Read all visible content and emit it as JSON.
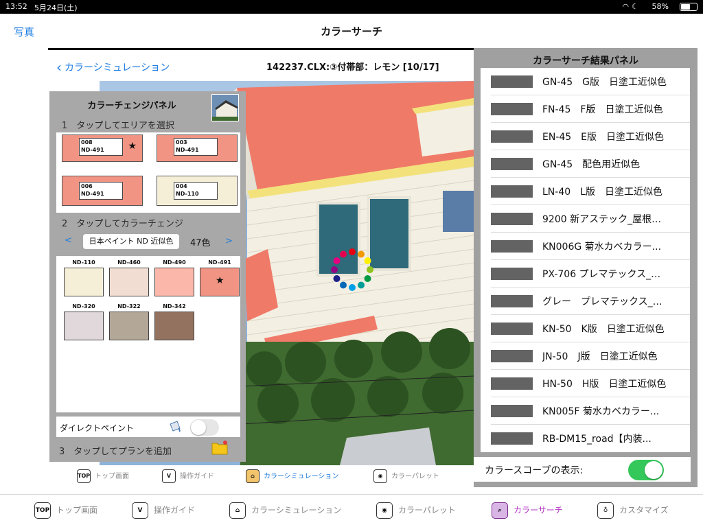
{
  "status_bar": {
    "time": "13:52",
    "date": "5月24日(土)",
    "battery": "58%",
    "battery_level": 0.58
  },
  "nav": {
    "back_label": "写真",
    "title": "カラーサーチ"
  },
  "sim": {
    "back_label": "カラーシミュレーション",
    "file_title": "142237.CLX:③付帯部：レモン [10/17]"
  },
  "change_panel": {
    "title": "カラーチェンジパネル",
    "step1": "1　タップしてエリアを選択",
    "areas": [
      {
        "code": "008",
        "name": "ND-491",
        "color": "#f19484",
        "starred": true
      },
      {
        "code": "003",
        "name": "ND-491",
        "color": "#f19484",
        "starred": false
      },
      {
        "code": "006",
        "name": "ND-491",
        "color": "#f19484",
        "starred": false
      },
      {
        "code": "004",
        "name": "ND-110",
        "color": "#f6efd8",
        "starred": false
      }
    ],
    "step2": "2　タップしてカラーチェンジ",
    "brand_prev": "<",
    "brand_name": "日本ペイント ND 近似色",
    "brand_count": "47色",
    "brand_next": ">",
    "swatches": [
      {
        "name": "ND-110",
        "color": "#f6efd8",
        "starred": false
      },
      {
        "name": "ND-460",
        "color": "#f1ddd2",
        "starred": false
      },
      {
        "name": "ND-490",
        "color": "#fbb7aa",
        "starred": false
      },
      {
        "name": "ND-491",
        "color": "#f19484",
        "starred": true
      },
      {
        "name": "ND-320",
        "color": "#e0d8da",
        "starred": false
      },
      {
        "name": "ND-322",
        "color": "#b3a898",
        "starred": false
      },
      {
        "name": "ND-342",
        "color": "#93725f",
        "starred": false
      }
    ],
    "direct_paint_label": "ダイレクトペイント",
    "direct_paint_on": false,
    "step3": "3　タップしてプランを追加"
  },
  "result_panel": {
    "title": "カラーサーチ結果パネル",
    "results": [
      "GN-45　G版　日塗工近似色",
      "FN-45　F版　日塗工近似色",
      "EN-45　E版　日塗工近似色",
      "GN-45　配色用近似色",
      "LN-40　L版　日塗工近似色",
      "9200  新アステック_屋根…",
      "KN006G  菊水カベカラー...",
      "PX-706  プレマテックス_…",
      "グレー　プレマテックス_…",
      "KN-50　K版　日塗工近似色",
      "JN-50　J版　日塗工近似色",
      "HN-50　H版　日塗工近似色",
      "KN005F  菊水カベカラー...",
      "RB-DM15_road【内装..."
    ],
    "result_color": "#636363",
    "scope_label": "カラースコープの表示:",
    "scope_on": true
  },
  "inner_tabs": [
    {
      "icon": "TOP",
      "label": "トップ画面",
      "active": false
    },
    {
      "icon": "",
      "label": "操作ガイド",
      "active": false
    },
    {
      "icon": "",
      "label": "カラーシミュレーション",
      "active": true
    },
    {
      "icon": "",
      "label": "カラーパレット",
      "active": false
    }
  ],
  "main_tabs": [
    {
      "icon": "TOP",
      "label": "トップ画面",
      "active": false
    },
    {
      "icon": "",
      "label": "操作ガイド",
      "active": false
    },
    {
      "icon": "",
      "label": "カラーシミュレーション",
      "active": false
    },
    {
      "icon": "",
      "label": "カラーパレット",
      "active": false
    },
    {
      "icon": "",
      "label": "カラーサーチ",
      "active": true
    },
    {
      "icon": "",
      "label": "カスタマイズ",
      "active": false
    }
  ]
}
